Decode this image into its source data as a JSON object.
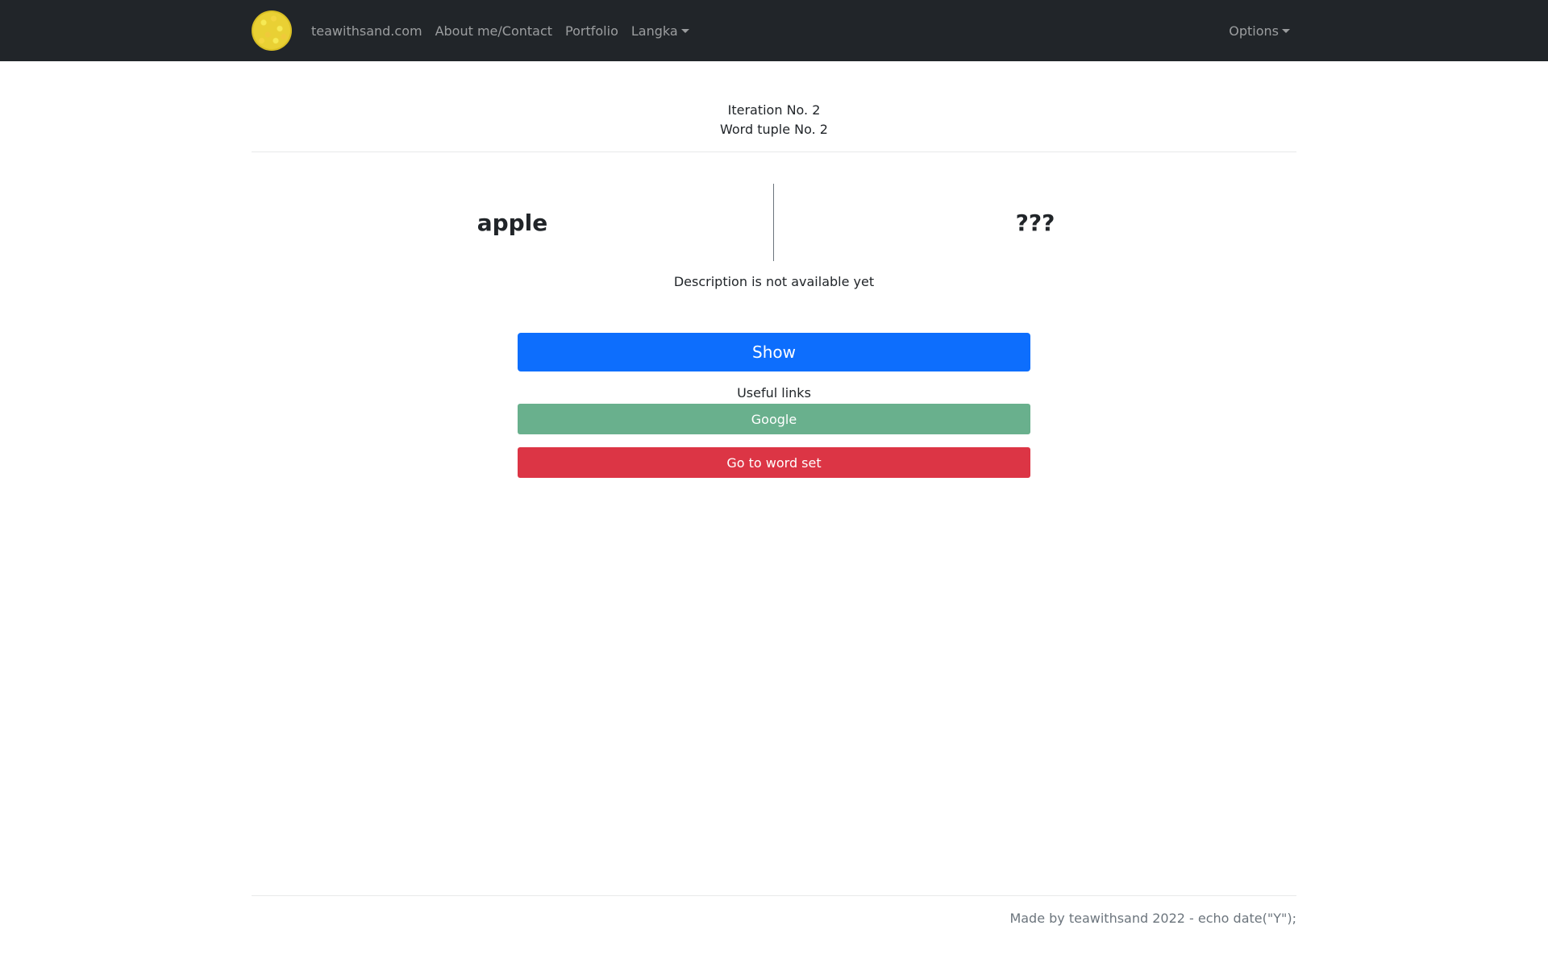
{
  "navbar": {
    "logo_icon": "grapefruit-logo-icon",
    "links": [
      {
        "label": "teawithsand.com"
      },
      {
        "label": "About me/Contact"
      },
      {
        "label": "Portfolio"
      },
      {
        "label": "Langka"
      }
    ],
    "options_label": "Options"
  },
  "header": {
    "iteration": "Iteration No. 2",
    "word_tuple": "Word tuple No. 2"
  },
  "words": {
    "left": "apple",
    "right": "???"
  },
  "description": "Description is not available yet",
  "buttons": {
    "show": "Show",
    "google": "Google",
    "go_to_word_set": "Go to word set"
  },
  "useful_links_label": "Useful links",
  "footer": {
    "text": "Made by teawithsand 2022 - echo date(\"Y\");"
  },
  "colors": {
    "navbar_bg": "#212529",
    "primary": "#0d6efd",
    "google": "#69b08d",
    "danger": "#dc3545"
  }
}
